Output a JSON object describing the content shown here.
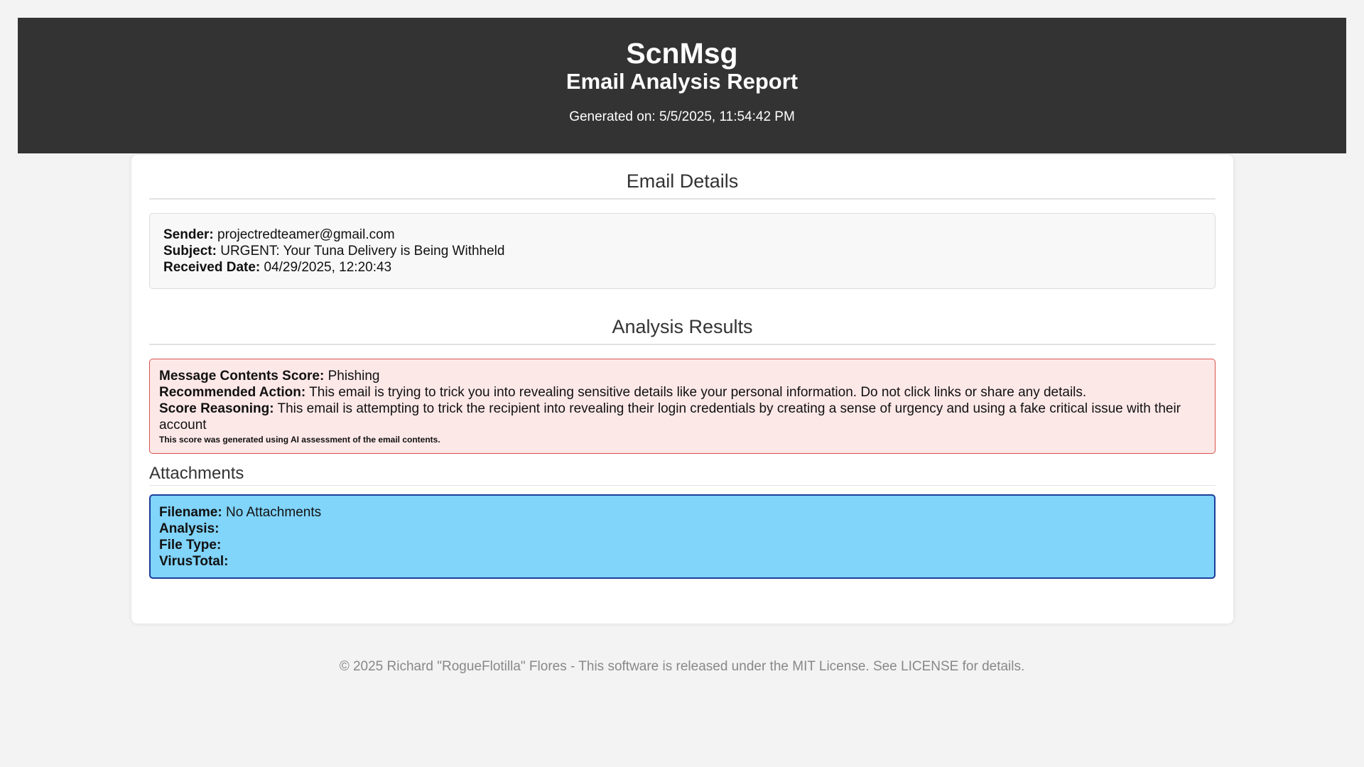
{
  "header": {
    "app_name": "ScnMsg",
    "title": "Email Analysis Report",
    "generated_label": "Generated on:",
    "generated_value": "5/5/2025, 11:54:42 PM"
  },
  "email_details": {
    "title": "Email Details",
    "sender_label": "Sender:",
    "sender_value": "projectredteamer@gmail.com",
    "subject_label": "Subject:",
    "subject_value": "URGENT: Your Tuna Delivery is Being Withheld",
    "received_label": "Received Date:",
    "received_value": "04/29/2025, 12:20:43"
  },
  "analysis": {
    "title": "Analysis Results",
    "score_label": "Message Contents Score:",
    "score_value": "Phishing",
    "action_label": "Recommended Action:",
    "action_value": "This email is trying to trick you into revealing sensitive details like your personal information. Do not click links or share any details.",
    "reasoning_label": "Score Reasoning:",
    "reasoning_value": "This email is attempting to trick the recipient into revealing their login credentials by creating a sense of urgency and using a fake critical issue with their account",
    "ai_note": "This score was generated using AI assessment of the email contents.",
    "status_color": "#fde8e8",
    "border_color": "#d9534f"
  },
  "attachments": {
    "title": "Attachments",
    "filename_label": "Filename:",
    "filename_value": "No Attachments",
    "analysis_label": "Analysis:",
    "analysis_value": "",
    "filetype_label": "File Type:",
    "filetype_value": "",
    "virustotal_label": "VirusTotal:",
    "virustotal_value": "",
    "box_color": "#81d4fa"
  },
  "footer": {
    "text": "© 2025 Richard \"RogueFlotilla\" Flores - This software is released under the MIT License. See LICENSE for details."
  }
}
